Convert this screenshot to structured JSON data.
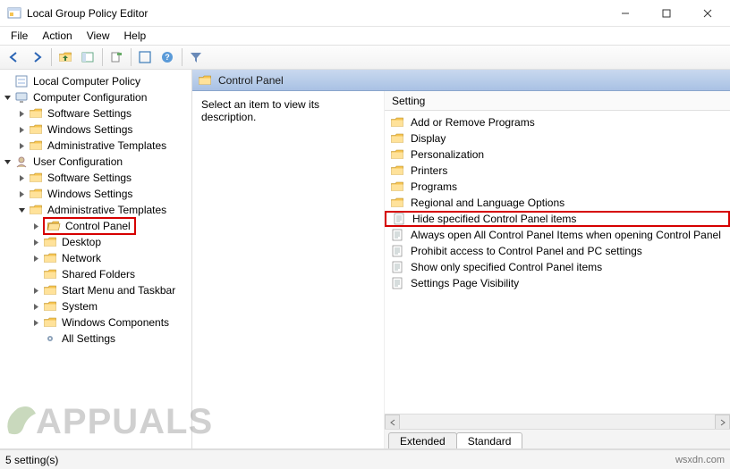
{
  "window": {
    "title": "Local Group Policy Editor"
  },
  "menus": {
    "file": "File",
    "action": "Action",
    "view": "View",
    "help": "Help"
  },
  "tree": {
    "root": "Local Computer Policy",
    "comp_config": "Computer Configuration",
    "cc_software": "Software Settings",
    "cc_windows": "Windows Settings",
    "cc_admin": "Administrative Templates",
    "user_config": "User Configuration",
    "uc_software": "Software Settings",
    "uc_windows": "Windows Settings",
    "uc_admin": "Administrative Templates",
    "control_panel": "Control Panel",
    "desktop": "Desktop",
    "network": "Network",
    "shared": "Shared Folders",
    "start_menu": "Start Menu and Taskbar",
    "system": "System",
    "win_components": "Windows Components",
    "all_settings": "All Settings"
  },
  "right": {
    "header": "Control Panel",
    "description": "Select an item to view its description.",
    "column": "Setting",
    "items": {
      "0": "Add or Remove Programs",
      "1": "Display",
      "2": "Personalization",
      "3": "Printers",
      "4": "Programs",
      "5": "Regional and Language Options",
      "6": "Hide specified Control Panel items",
      "7": "Always open All Control Panel Items when opening Control Panel",
      "8": "Prohibit access to Control Panel and PC settings",
      "9": "Show only specified Control Panel items",
      "10": "Settings Page Visibility"
    }
  },
  "tabs": {
    "extended": "Extended",
    "standard": "Standard"
  },
  "status": {
    "text": "5 setting(s)",
    "source": "wsxdn.com"
  },
  "watermark": "APPUALS"
}
